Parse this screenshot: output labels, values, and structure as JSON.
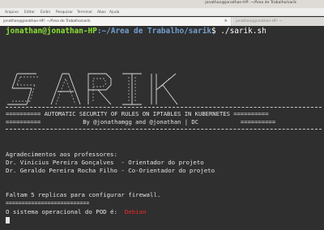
{
  "window": {
    "title": "jonathan@jonathan-HP: ~/Área de Trabalho/sarik"
  },
  "menu": {
    "items": [
      "Arquivo",
      "Editar",
      "Exibir",
      "Pesquisar",
      "Terminal",
      "Abas",
      "Ajuda"
    ]
  },
  "tabs": [
    {
      "label": "jonathan@jonathan-HP: ~/Área de Trabalho/sarik",
      "close": "×"
    },
    {
      "label": "jonathan@jonathan-HP: ~"
    }
  ],
  "prompt": {
    "user": "jonathan@jonathan-HP",
    "path": ":~/Área de Trabalho/sarik",
    "command": "$ ./sarik.sh"
  },
  "banner": {
    "art_text": "SARIK"
  },
  "heading": {
    "line1": "========== AUTOMATIC SECURITY OF RULES ON IPTABLES IN KUBERNETES ==========",
    "line2": "==========            By @jonathamgg and @jonathan | DC            =========="
  },
  "credits": {
    "thanks": "Agradecimentos aos professores:",
    "professor_1": "Dr. Vinicius Pereira Gonçalves  - Orientador do projeto",
    "professor_2": "Dr. Geraldo Pereira Rocha Filho - Co-Orientador do projeto"
  },
  "status": {
    "replicas_line": "Faltam 5 replicas para configurar firewall.",
    "separator": "==========================",
    "os_label": "O sistema operacional do POD é:  ",
    "os_value": "Debian"
  },
  "colors": {
    "prompt_user": "#8ae234",
    "prompt_path": "#729fcf",
    "os_value": "#ef2929",
    "terminal_bg": "#2f2f2f"
  }
}
